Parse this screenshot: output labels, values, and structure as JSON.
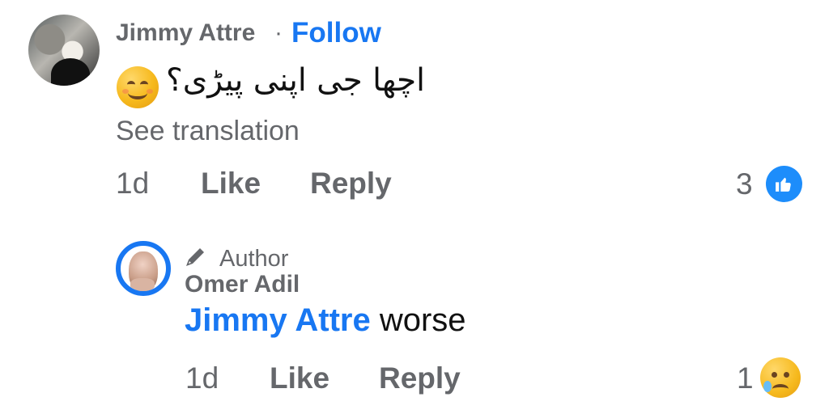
{
  "comment": {
    "author": "Jimmy Attre",
    "separator": "·",
    "follow_label": "Follow",
    "text": "اچھا جی اپنی پیڑی؟",
    "see_translation_label": "See translation",
    "time": "1d",
    "like_label": "Like",
    "reply_label": "Reply",
    "reaction_count": "3",
    "reaction_icon": "like-icon",
    "emoji_icon": "smiling-face-icon"
  },
  "reply": {
    "badge_label": "Author",
    "badge_icon": "pen-icon",
    "author": "Omer Adil",
    "mention": "Jimmy Attre",
    "text": " worse",
    "time": "1d",
    "like_label": "Like",
    "reply_label": "Reply",
    "reaction_count": "1",
    "reaction_icon": "sad-face-icon"
  },
  "colors": {
    "accent": "#1877f2",
    "secondary_text": "#65676b",
    "primary_text": "#111111",
    "like_icon": "#1d8dfb"
  }
}
